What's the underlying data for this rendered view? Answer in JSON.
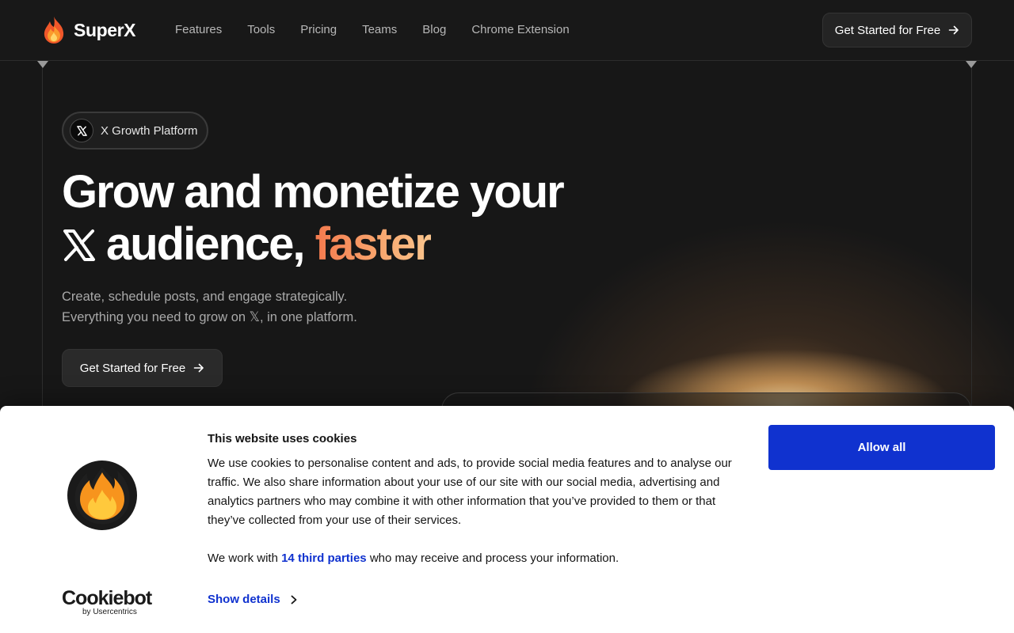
{
  "nav": {
    "brand_name": "SuperX",
    "links": [
      "Features",
      "Tools",
      "Pricing",
      "Teams",
      "Blog",
      "Chrome Extension"
    ],
    "cta_label": "Get Started for Free"
  },
  "hero": {
    "badge_label": "X Growth Platform",
    "headline_line1": "Grow and monetize your",
    "headline_line2": "audience,",
    "headline_highlight": "faster",
    "subtitle_line1": "Create, schedule posts, and engage strategically.",
    "subtitle_line2": "Everything you need to grow on 𝕏, in one platform.",
    "cta_label": "Get Started for Free"
  },
  "cookie_banner": {
    "title": "This website uses cookies",
    "body": "We use cookies to personalise content and ads, to provide social media features and to analyse our traffic. We also share information about your use of our site with our social media, advertising and analytics partners who may combine it with other information that you’ve provided to them or that they’ve collected from your use of their services.",
    "partners_prefix": "We work with",
    "partners_link": "14 third parties",
    "partners_suffix": "who may receive and process your information.",
    "show_details": "Show details",
    "allow_all": "Allow all",
    "provider_name": "Cookiebot",
    "provider_sub": "by Usercentrics"
  },
  "colors": {
    "background": "#171717",
    "accent_gradient_start": "#f47a4e",
    "accent_gradient_end": "#fbc68e",
    "cookie_primary": "#1032cf"
  },
  "icons": {
    "brand": "flame-icon",
    "badge": "x-logo-icon",
    "cta": "arrow-right-icon",
    "details": "chevron-right-icon"
  }
}
